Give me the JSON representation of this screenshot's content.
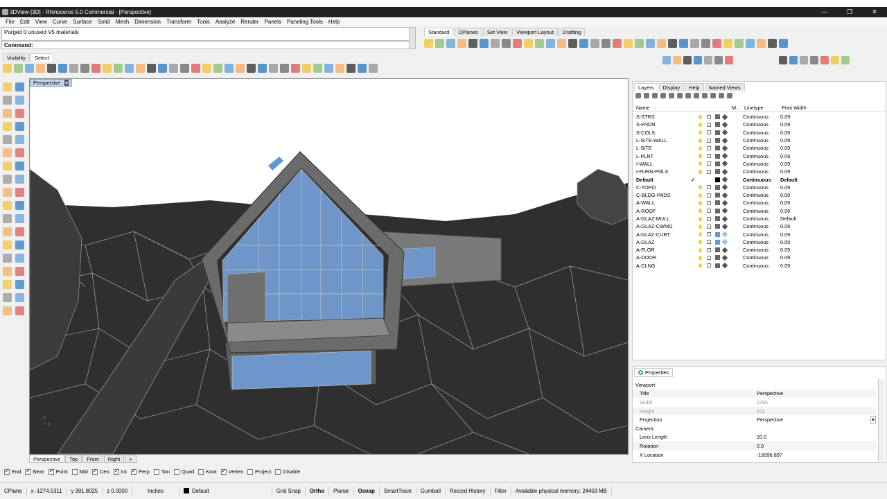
{
  "window": {
    "title": "3DView-[3D] - Rhinoceros 5.0 Commercial - [Perspective]"
  },
  "menu": [
    "File",
    "Edit",
    "View",
    "Curve",
    "Surface",
    "Solid",
    "Mesh",
    "Dimension",
    "Transform",
    "Tools",
    "Analyze",
    "Render",
    "Panels",
    "Paneling Tools",
    "Help"
  ],
  "command": {
    "history": "Purged 0 unused V5 materials",
    "prompt": "Command:"
  },
  "toolbar_tabs_right": [
    "Standard",
    "CPlanes",
    "Set View",
    "Viewport Layout",
    "Drafting"
  ],
  "toolbar_tabs_left": [
    "Visibility",
    "Select"
  ],
  "viewport": {
    "label": "Perspective"
  },
  "viewport_tabs": [
    "Perspective",
    "Top",
    "Front",
    "Right",
    "+"
  ],
  "panel_tabs": [
    "Layers",
    "Display",
    "Help",
    "Named Views"
  ],
  "layers": {
    "headers": {
      "name": "Name",
      "material": "M..",
      "linetype": "Linetype",
      "print_width": "Print Width"
    },
    "rows": [
      {
        "name": "S-STRS",
        "linetype": "Continuous",
        "width": "0.09"
      },
      {
        "name": "S-FNDN",
        "linetype": "Continuous",
        "width": "0.09"
      },
      {
        "name": "S-COLS",
        "linetype": "Continuous",
        "width": "0.09"
      },
      {
        "name": "L-SITE-WALL",
        "linetype": "Continuous",
        "width": "0.09"
      },
      {
        "name": "L-SITE",
        "linetype": "Continuous",
        "width": "0.09"
      },
      {
        "name": "L-PLNT",
        "linetype": "Continuous",
        "width": "0.09"
      },
      {
        "name": "I-WALL",
        "linetype": "Continuous",
        "width": "0.09"
      },
      {
        "name": "I-FURN-PNLS",
        "linetype": "Continuous",
        "width": "0.09"
      },
      {
        "name": "Default",
        "linetype": "Continuous",
        "width": "Default",
        "current": "✓"
      },
      {
        "name": "C-TOPO",
        "linetype": "Continuous",
        "width": "0.09"
      },
      {
        "name": "C-BLDG-PADS",
        "linetype": "Continuous",
        "width": "0.09"
      },
      {
        "name": "A-WALL",
        "linetype": "Continuous",
        "width": "0.09"
      },
      {
        "name": "A-ROOF",
        "linetype": "Continuous",
        "width": "0.09"
      },
      {
        "name": "A-GLAZ-MULL",
        "linetype": "Continuous",
        "width": "Default"
      },
      {
        "name": "A-GLAZ-CWMG",
        "linetype": "Continuous",
        "width": "0.09"
      },
      {
        "name": "A-GLAZ-CURT",
        "linetype": "Continuous",
        "width": "0.09"
      },
      {
        "name": "A-GLAZ",
        "linetype": "Continuous",
        "width": "0.09"
      },
      {
        "name": "A-FLOR",
        "linetype": "Continuous",
        "width": "0.09"
      },
      {
        "name": "A-DOOR",
        "linetype": "Continuous",
        "width": "0.09"
      },
      {
        "name": "A-CLNG",
        "linetype": "Continuous",
        "width": "0.09"
      }
    ]
  },
  "properties": {
    "tab": "Properties",
    "rows": [
      {
        "k": "Viewport",
        "v": "",
        "sec": true
      },
      {
        "k": "Title",
        "v": "Perspective"
      },
      {
        "k": "Width",
        "v": "1296",
        "dim": true
      },
      {
        "k": "Height",
        "v": "811",
        "dim": true
      },
      {
        "k": "Projection",
        "v": "Perspective"
      },
      {
        "k": "Camera",
        "v": "",
        "sec": true
      },
      {
        "k": "Lens Length",
        "v": "20.0"
      },
      {
        "k": "Rotation",
        "v": "0.0"
      },
      {
        "k": "X Location",
        "v": "-16096.897"
      }
    ]
  },
  "osnaps": [
    {
      "label": "End",
      "checked": true
    },
    {
      "label": "Near",
      "checked": true
    },
    {
      "label": "Point",
      "checked": true
    },
    {
      "label": "Mid",
      "checked": false
    },
    {
      "label": "Cen",
      "checked": true
    },
    {
      "label": "Int",
      "checked": true
    },
    {
      "label": "Perp",
      "checked": true
    },
    {
      "label": "Tan",
      "checked": false
    },
    {
      "label": "Quad",
      "checked": false
    },
    {
      "label": "Knot",
      "checked": false
    },
    {
      "label": "Vertex",
      "checked": true
    },
    {
      "label": "Project",
      "checked": false
    },
    {
      "label": "Disable",
      "checked": false
    }
  ],
  "status": {
    "cplane": "CPlane",
    "x": "x -1274.5311",
    "y": "y 991.8025",
    "z": "z 0.0000",
    "units": "Inches",
    "layer": "Default",
    "toggles": [
      "Grid Snap",
      "Ortho",
      "Planar",
      "Osnap",
      "SmartTrack",
      "Gumball",
      "Record History",
      "Filter"
    ],
    "memory": "Available physical memory: 24403 MB"
  },
  "colors": {
    "glass": "#6f96c8",
    "dark": "#2e2e2e",
    "accent": "#5b9bd5"
  }
}
